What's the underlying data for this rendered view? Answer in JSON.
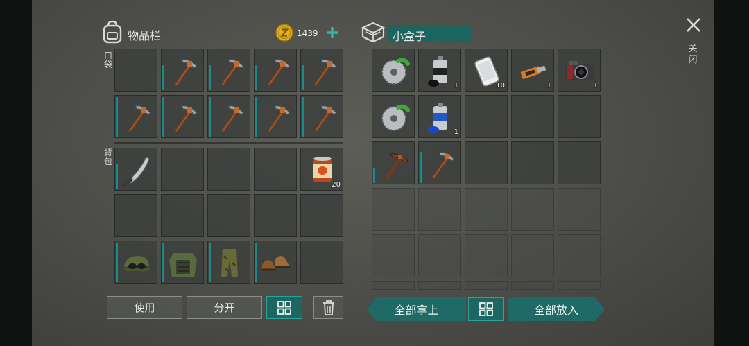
{
  "inventory": {
    "title": "物品栏",
    "coins": "1439",
    "pocket_label": "口袋",
    "backpack_label": "背包"
  },
  "container": {
    "title": "小盒子"
  },
  "close_label": "关闭",
  "buttons": {
    "use": "使用",
    "split": "分开",
    "take_all": "全部拿上",
    "put_all": "全部放入"
  },
  "pocket_slots": [
    {
      "item": "empty"
    },
    {
      "item": "pickaxe",
      "durability": 0.6
    },
    {
      "item": "pickaxe",
      "durability": 0.6
    },
    {
      "item": "pickaxe",
      "durability": 0.6
    },
    {
      "item": "pickaxe",
      "durability": 0.6
    },
    {
      "item": "pickaxe",
      "durability": 0.95
    },
    {
      "item": "pickaxe",
      "durability": 0.95
    },
    {
      "item": "pickaxe",
      "durability": 0.95
    },
    {
      "item": "pickaxe",
      "durability": 0.95
    },
    {
      "item": "pickaxe",
      "durability": 0.95
    }
  ],
  "backpack_slots": [
    {
      "item": "machete",
      "durability": 0.6
    },
    {
      "item": "empty"
    },
    {
      "item": "empty"
    },
    {
      "item": "empty"
    },
    {
      "item": "canned-food",
      "count": "20"
    },
    {
      "item": "empty"
    },
    {
      "item": "empty"
    },
    {
      "item": "empty"
    },
    {
      "item": "empty"
    },
    {
      "item": "empty"
    },
    {
      "item": "cap-goggles",
      "durability": 0.95
    },
    {
      "item": "camo-vest",
      "durability": 0.95
    },
    {
      "item": "camo-pants",
      "durability": 0.95
    },
    {
      "item": "boots",
      "durability": 0.95
    },
    {
      "item": "empty"
    }
  ],
  "box_slots": [
    {
      "item": "saw-blade"
    },
    {
      "item": "spray-can-black",
      "count": "1"
    },
    {
      "item": "smartphone",
      "count": "10"
    },
    {
      "item": "usb-drive",
      "count": "1"
    },
    {
      "item": "camera",
      "count": "1"
    },
    {
      "item": "saw-blade"
    },
    {
      "item": "spray-can-blue",
      "count": "1"
    },
    {
      "item": "empty"
    },
    {
      "item": "empty"
    },
    {
      "item": "empty"
    },
    {
      "item": "pickaxe-red",
      "durability": 0.35
    },
    {
      "item": "pickaxe",
      "durability": 0.75
    },
    {
      "item": "empty"
    },
    {
      "item": "empty"
    },
    {
      "item": "empty"
    }
  ],
  "colors": {
    "accent": "#1f6a66",
    "accent_border": "#2aa39c",
    "coin": "#e3b020",
    "durability": "#1c8a86"
  }
}
